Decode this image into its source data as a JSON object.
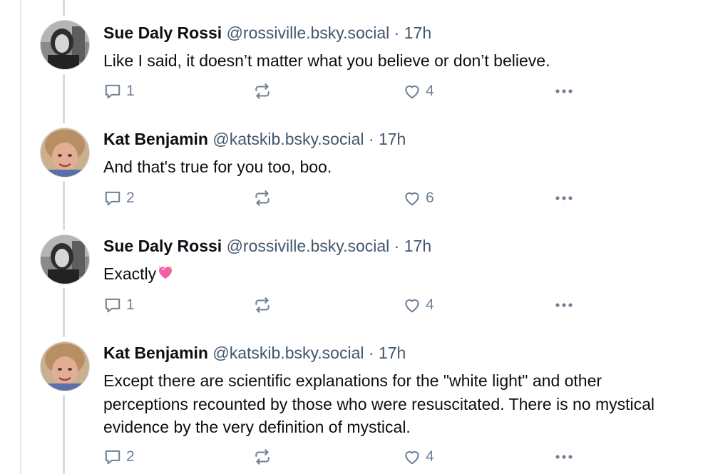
{
  "posts": [
    {
      "author_name": "Sue Daly Rossi",
      "handle": "@rossiville.bsky.social",
      "separator": "·",
      "time": "17h",
      "text": "Like I said, it doesn’t matter what you believe or don’t believe.",
      "reply_count": "1",
      "like_count": "4",
      "avatar": "sue-avatar"
    },
    {
      "author_name": "Kat Benjamin",
      "handle": "@katskib.bsky.social",
      "separator": "·",
      "time": "17h",
      "text": "And that's true for you too, boo.",
      "reply_count": "2",
      "like_count": "6",
      "avatar": "kat-avatar"
    },
    {
      "author_name": "Sue Daly Rossi",
      "handle": "@rossiville.bsky.social",
      "separator": "·",
      "time": "17h",
      "text": "Exactly",
      "emoji": "sparkling-heart-emoji",
      "reply_count": "1",
      "like_count": "4",
      "avatar": "sue-avatar"
    },
    {
      "author_name": "Kat Benjamin",
      "handle": "@katskib.bsky.social",
      "separator": "·",
      "time": "17h",
      "text": "Except there are scientific explanations for the \"white light\" and other perceptions recounted by those who were resuscitated. There is no mystical evidence by the very definition of mystical.",
      "reply_count": "2",
      "like_count": "4",
      "avatar": "kat-avatar"
    }
  ],
  "icons": {
    "reply": "speech-bubble-icon",
    "repost": "repost-arrows-icon",
    "like": "heart-outline-icon",
    "more": "ellipsis-icon"
  },
  "colors": {
    "text": "#0b0f14",
    "muted": "#42576c",
    "icon": "#6f8194",
    "thread_line": "#d4dbe2"
  }
}
